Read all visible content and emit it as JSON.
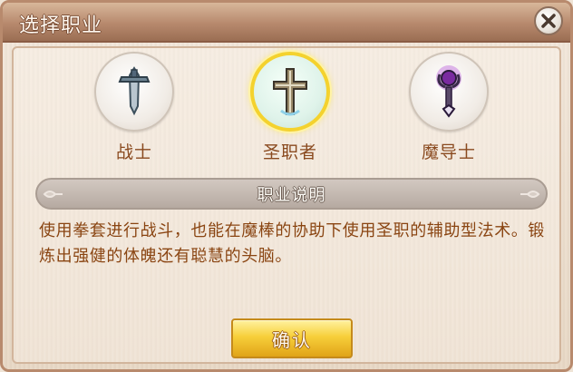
{
  "dialog": {
    "title": "选择职业",
    "close_icon": "close-icon"
  },
  "jobs": [
    {
      "label": "战士",
      "icon": "sword-icon",
      "selected": false
    },
    {
      "label": "圣职者",
      "icon": "holy-cross-icon",
      "selected": true
    },
    {
      "label": "魔导士",
      "icon": "magic-staff-icon",
      "selected": false
    }
  ],
  "description": {
    "heading": "职业说明",
    "text": "使用拳套进行战斗，也能在魔棒的协助下使用圣职的辅助型法术。锻炼出强健的体魄还有聪慧的头脑。"
  },
  "actions": {
    "confirm_label": "确认"
  },
  "colors": {
    "title_bar": "#b7896d",
    "job_label": "#8a4a1f",
    "selected_ring": "#f4d22e",
    "confirm_button": "#f7cf3a",
    "description_text": "#8a4512"
  }
}
